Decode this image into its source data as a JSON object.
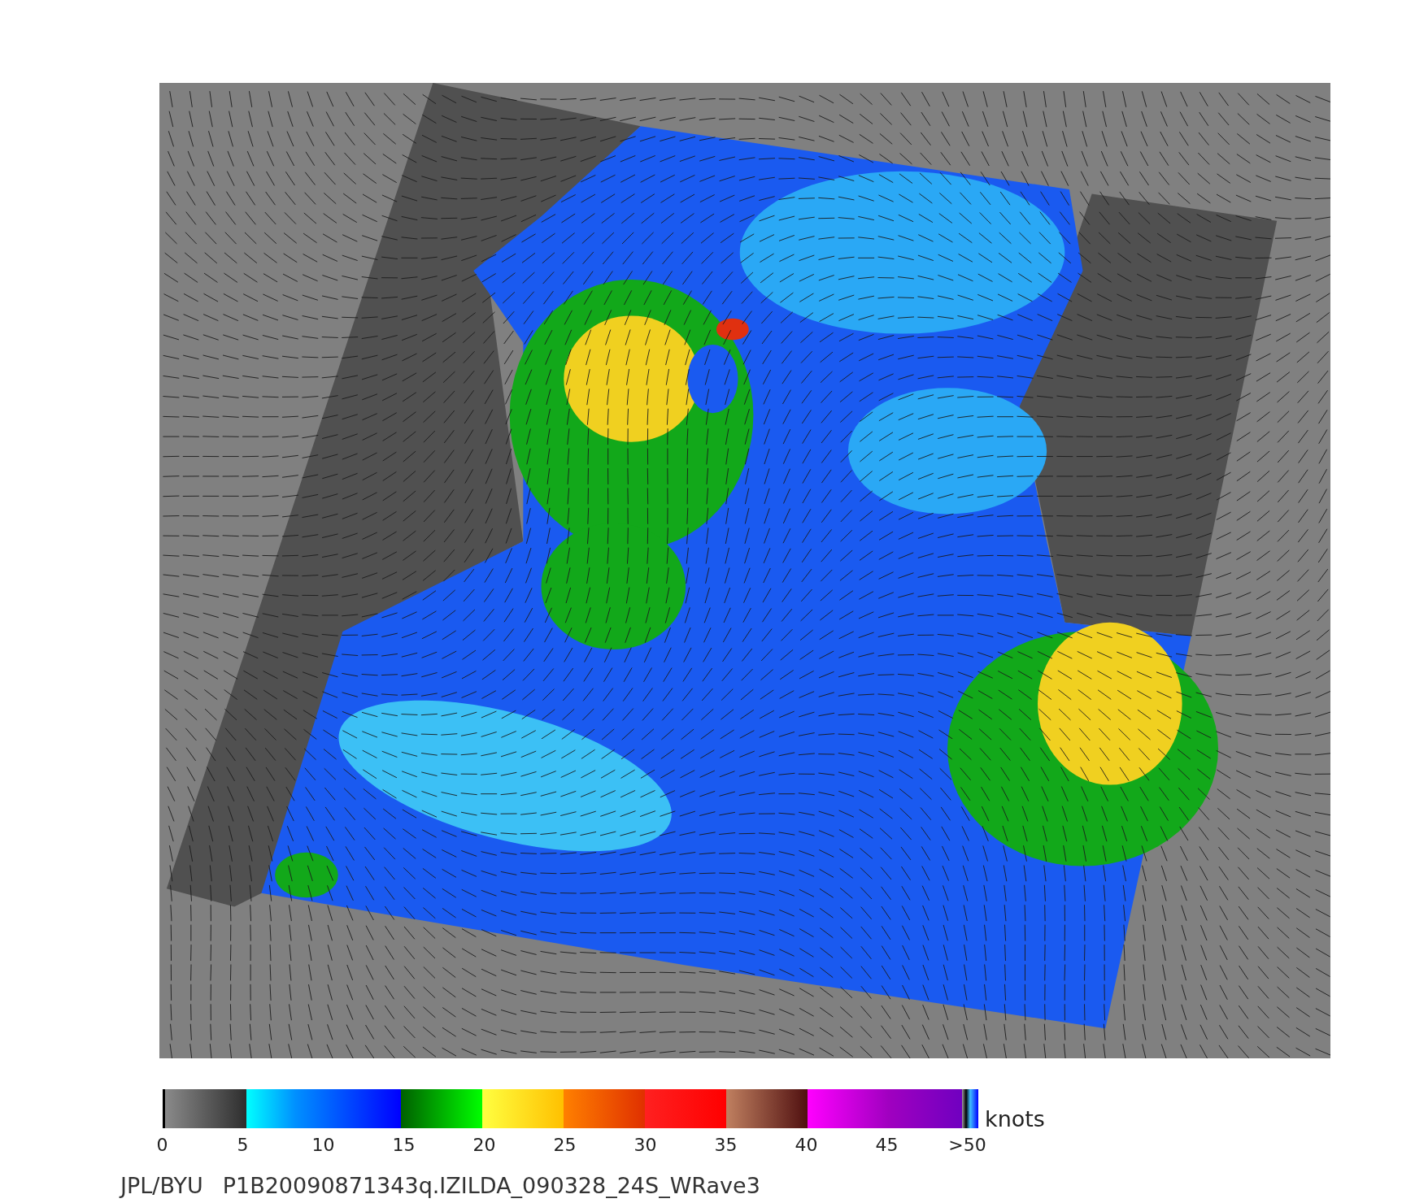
{
  "map": {
    "kind": "wind-speed"
  },
  "colorbar": {
    "unit": "knots",
    "ticks": [
      "0",
      "5",
      "10",
      "15",
      "20",
      "25",
      "30",
      "35",
      "40",
      "45",
      ">50"
    ]
  },
  "caption": {
    "source": "JPL/BYU",
    "file": "P1B20090871343q.IZILDA_090328_24S_WRave3"
  }
}
